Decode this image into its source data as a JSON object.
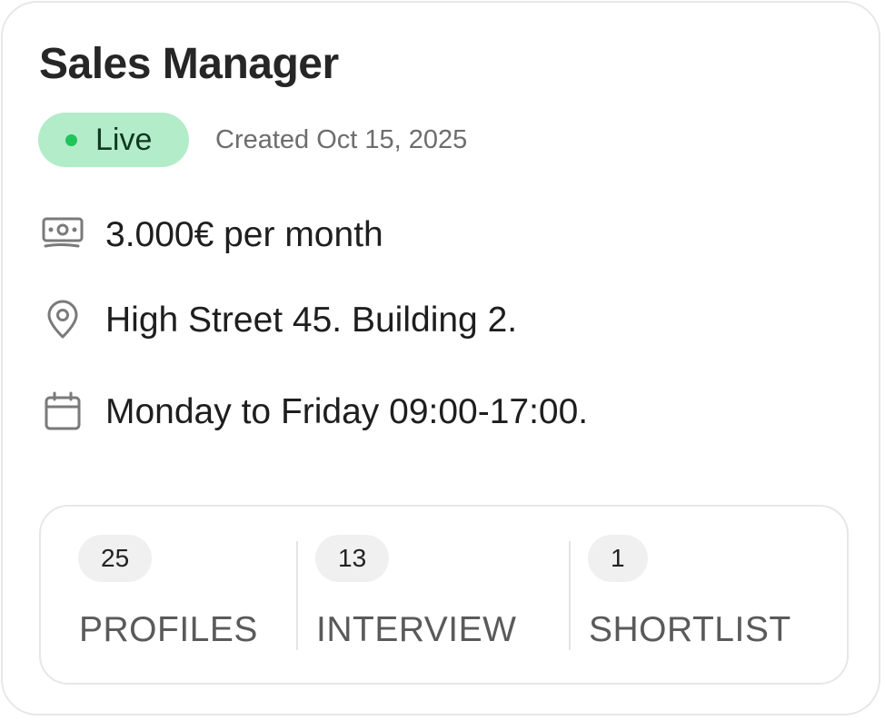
{
  "job": {
    "title": "Sales Manager",
    "status": "Live",
    "created": "Created Oct 15, 2025"
  },
  "details": {
    "salary": {
      "icon": "money-icon",
      "text": "3.000€ per month"
    },
    "location": {
      "icon": "location-pin-icon",
      "text": "High Street 45. Building 2."
    },
    "schedule": {
      "icon": "calendar-icon",
      "text": "Monday to Friday 09:00-17:00."
    }
  },
  "stats": [
    {
      "count": "25",
      "label": "PROFILES"
    },
    {
      "count": "13",
      "label": "INTERVIEW"
    },
    {
      "count": "1",
      "label": "SHORTLIST"
    }
  ],
  "colors": {
    "live_badge_bg": "#b3ecc8",
    "live_dot": "#1fc45a",
    "live_text": "#10381f",
    "border": "#e7e7e7",
    "icon": "#7a7a7a"
  }
}
